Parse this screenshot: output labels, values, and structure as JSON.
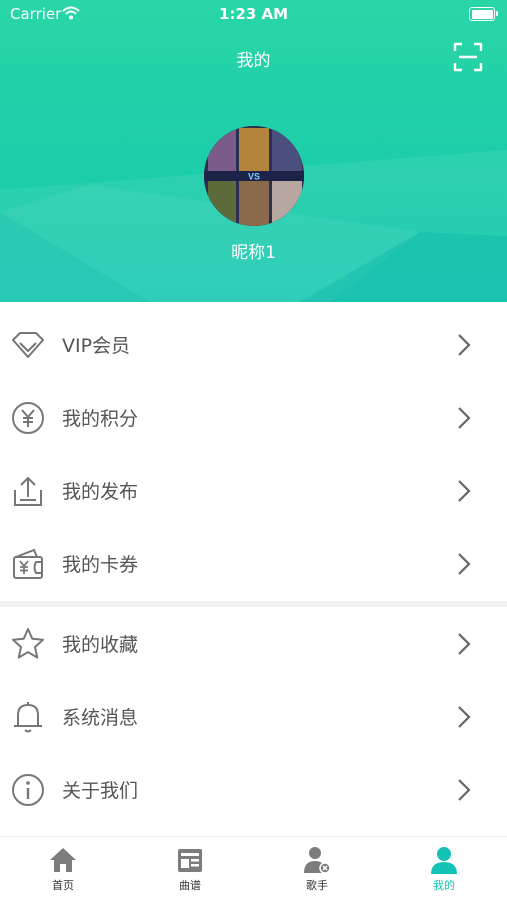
{
  "status_bar": {
    "carrier": "Carrier",
    "time": "1:23 AM"
  },
  "header": {
    "title": "我的",
    "nickname": "昵称1",
    "avatar_badge": "VS"
  },
  "colors": {
    "accent": "#1fcfa9",
    "tab_active": "#14c3b6",
    "icon_gray": "#666666"
  },
  "menu": [
    {
      "label": "VIP会员",
      "icon": "diamond-icon"
    },
    {
      "label": "我的积分",
      "icon": "yen-coin-icon"
    },
    {
      "label": "我的发布",
      "icon": "upload-tray-icon"
    },
    {
      "label": "我的卡券",
      "icon": "wallet-coupon-icon"
    },
    {
      "label": "我的收藏",
      "icon": "star-icon"
    },
    {
      "label": "系统消息",
      "icon": "bell-icon"
    },
    {
      "label": "关于我们",
      "icon": "info-icon"
    }
  ],
  "tabs": [
    {
      "label": "首页",
      "icon": "home-icon",
      "active": false
    },
    {
      "label": "曲谱",
      "icon": "sheet-music-icon",
      "active": false
    },
    {
      "label": "歌手",
      "icon": "singer-icon",
      "active": false
    },
    {
      "label": "我的",
      "icon": "profile-icon",
      "active": true
    }
  ]
}
